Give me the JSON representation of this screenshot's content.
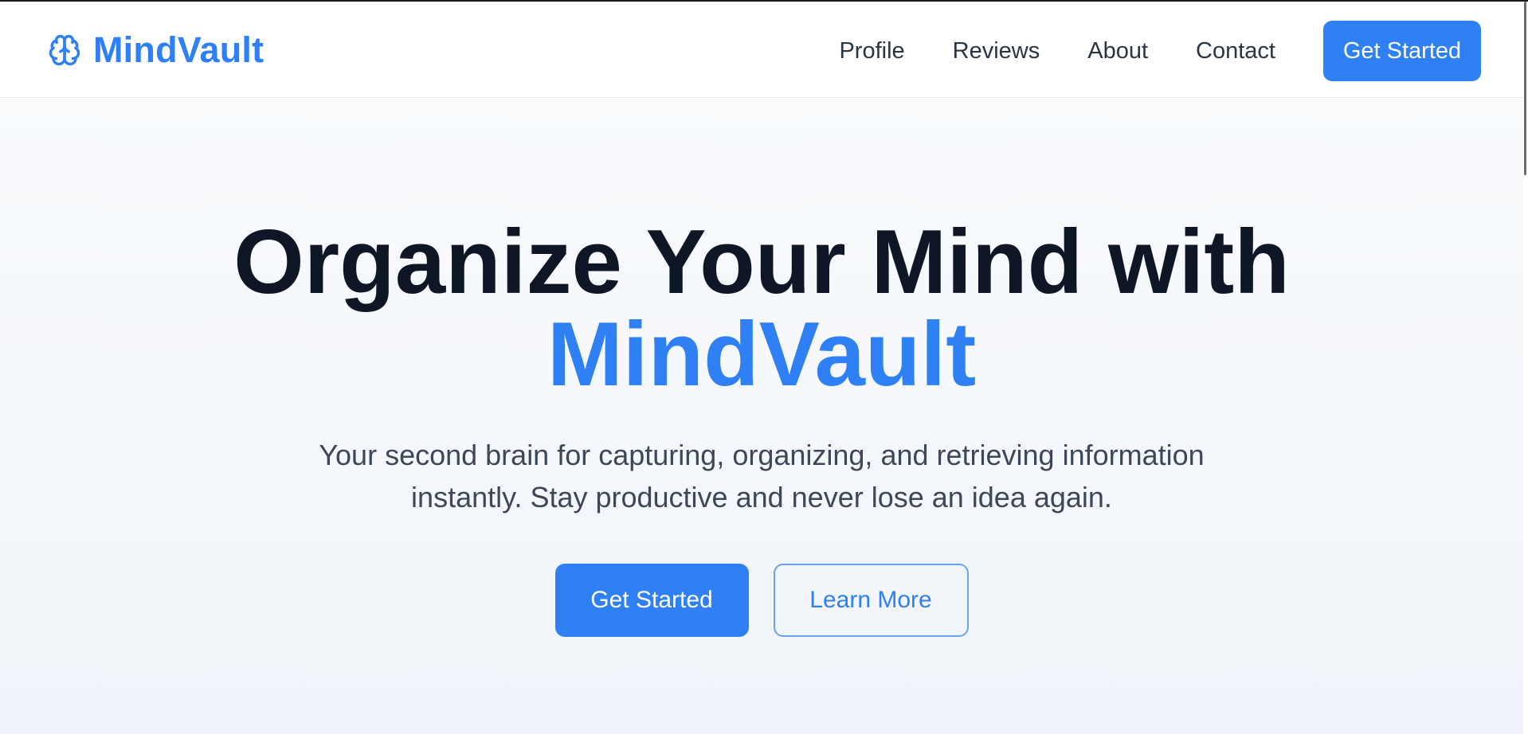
{
  "brand": {
    "name": "MindVault",
    "icon": "brain-icon",
    "color": "#2f80f5"
  },
  "nav": {
    "items": [
      {
        "label": "Profile"
      },
      {
        "label": "Reviews"
      },
      {
        "label": "About"
      },
      {
        "label": "Contact"
      }
    ],
    "cta_label": "Get Started"
  },
  "hero": {
    "title_line1": "Organize Your Mind with",
    "title_line2": "MindVault",
    "subtitle": "Your second brain for capturing, organizing, and retrieving information instantly. Stay productive and never lose an idea again.",
    "primary_label": "Get Started",
    "secondary_label": "Learn More"
  },
  "colors": {
    "accent": "#2f80f5",
    "heading": "#0f1726",
    "body_text": "#3d4757"
  }
}
